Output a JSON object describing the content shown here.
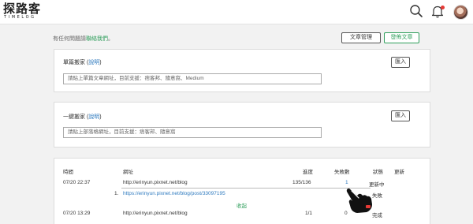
{
  "header": {
    "logo_main": "探路客",
    "logo_sub": "TIMELOG",
    "icons": [
      "search-icon",
      "bell-icon",
      "avatar"
    ],
    "notification_dot_color": "#e53935"
  },
  "helpline": {
    "text": "有任何問題請",
    "link": "聯絡我們",
    "suffix": "。"
  },
  "actions": {
    "manage_label": "文章管理",
    "publish_label": "發佈文章"
  },
  "single_import": {
    "title": "單篇搬家",
    "hint_open": " (",
    "hint": "說明",
    "hint_close": ")",
    "button": "匯入",
    "placeholder": "請貼上單篇文章網址，目前支援：痞客邦、隨意窩、Medium"
  },
  "bulk_import": {
    "title": "一鍵搬家",
    "hint_open": " (",
    "hint": "說明",
    "hint_close": ")",
    "button": "匯入",
    "placeholder": "請貼上部落格網址，目前支援：痞客邦、隨意窩"
  },
  "history": {
    "columns": [
      "時間",
      "網址",
      "進度",
      "失敗數",
      "狀態",
      "更新"
    ],
    "rows": [
      {
        "time": "07/20 22:37",
        "url": "http://erinyun.pixnet.net/blog",
        "progress": "135/136",
        "failed": "1",
        "status": "更新中"
      },
      {
        "time": "07/20 13:29",
        "url": "http://erinyun.pixnet.net/blog",
        "progress": "1/1",
        "failed": "0",
        "status": "完成"
      }
    ],
    "failed_item": {
      "index": "1.",
      "url": "https://erinyun.pixnet.net/blog/post/33097195",
      "status": "失敗",
      "collapse": "收起"
    }
  },
  "colors": {
    "accent_green": "#2e9e5b",
    "link_blue": "#2e7abf",
    "background": "#f2f2f2"
  }
}
